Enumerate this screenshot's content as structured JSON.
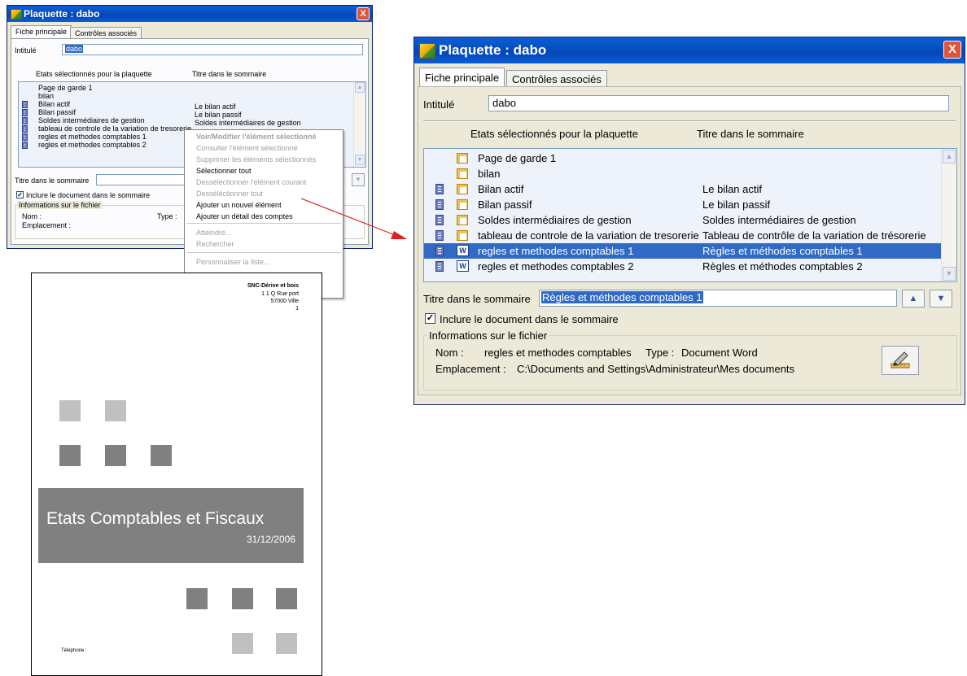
{
  "small_window": {
    "title": "Plaquette : dabo",
    "close": "X",
    "tabs": [
      "Fiche principale",
      "Contrôles associés"
    ],
    "intitule_label": "Intitulé",
    "intitule_value": "dabo",
    "col_states": "Etats sélectionnés pour la plaquette",
    "col_title": "Titre dans le sommaire",
    "rows": [
      {
        "name": "Page de garde 1",
        "title": ""
      },
      {
        "name": "bilan",
        "title": ""
      },
      {
        "name": "Bilan actif",
        "title": "Le bilan actif"
      },
      {
        "name": "Bilan passif",
        "title": "Le bilan passif"
      },
      {
        "name": "Soldes intermédiaires de gestion",
        "title": "Soldes intermédiaires de gestion"
      },
      {
        "name": "tableau de controle de la variation de tresorerie",
        "title": ""
      },
      {
        "name": "regles et methodes comptables 1",
        "title": ""
      },
      {
        "name": "regles et methodes comptables 2",
        "title": ""
      }
    ],
    "titre_label": "Titre dans le sommaire",
    "include_label": "Inclure le document dans le sommaire",
    "info_legend": "Informations sur le fichier",
    "nom_label": "Nom :",
    "type_label": "Type :",
    "emplacement_label": "Emplacement :"
  },
  "context_menu": {
    "items": [
      {
        "label": "Voir/Modifier l'élément sélectionné",
        "state": "bold"
      },
      {
        "label": "Consulter l'élément sélectionné",
        "state": "disabled"
      },
      {
        "label": "Supprimer les éléments sélectionnés",
        "state": "disabled"
      },
      {
        "label": "Sélectionner tout",
        "state": "enabled"
      },
      {
        "label": "Desséléctionner l'élément courant",
        "state": "disabled"
      },
      {
        "label": "Desséléctionner tout",
        "state": "disabled"
      },
      {
        "label": "Ajouter un nouvel élément",
        "state": "enabled"
      },
      {
        "label": "Ajouter un détail des comptes",
        "state": "enabled"
      },
      {
        "label": "Atteindre...",
        "state": "disabled"
      },
      {
        "label": "Rechercher",
        "state": "disabled"
      },
      {
        "label": "Personnaliser la liste...",
        "state": "disabled"
      }
    ]
  },
  "large_window": {
    "title": "Plaquette : dabo",
    "close": "X",
    "tabs": [
      "Fiche principale",
      "Contrôles associés"
    ],
    "intitule_label": "Intitulé",
    "intitule_value": "dabo",
    "col_states": "Etats sélectionnés pour la plaquette",
    "col_title": "Titre dans le sommaire",
    "rows": [
      {
        "name": "Page de garde 1",
        "title": "",
        "book": false,
        "icon": "sheet",
        "selected": false
      },
      {
        "name": "bilan",
        "title": "",
        "book": false,
        "icon": "sheet",
        "selected": false
      },
      {
        "name": "Bilan actif",
        "title": "Le bilan actif",
        "book": true,
        "icon": "sheet",
        "selected": false
      },
      {
        "name": "Bilan passif",
        "title": "Le bilan passif",
        "book": true,
        "icon": "sheet",
        "selected": false
      },
      {
        "name": "Soldes intermédiaires de gestion",
        "title": "Soldes intermédiaires de gestion",
        "book": true,
        "icon": "sheet",
        "selected": false
      },
      {
        "name": "tableau de controle de la variation de tresorerie",
        "title": "Tableau de contrôle de la variation de trésorerie",
        "book": true,
        "icon": "sheet",
        "selected": false
      },
      {
        "name": "regles et methodes comptables 1",
        "title": "Règles et méthodes comptables 1",
        "book": true,
        "icon": "word",
        "selected": true
      },
      {
        "name": "regles et methodes comptables 2",
        "title": "Règles et méthodes comptables 2",
        "book": true,
        "icon": "word",
        "selected": false
      }
    ],
    "titre_label": "Titre dans le sommaire",
    "titre_value": "Règles et méthodes comptables 1",
    "include_label": "Inclure le document dans le sommaire",
    "include_checked": true,
    "info_legend": "Informations sur le fichier",
    "nom_label": "Nom :",
    "nom_value": "regles et methodes comptables",
    "type_label": "Type :",
    "type_value": "Document Word",
    "emplacement_label": "Emplacement :",
    "emplacement_value": "C:\\Documents and Settings\\Administrateur\\Mes documents"
  },
  "cover_page": {
    "company": "SNC-Dérive et bois",
    "address": "1 1 Q Rue port",
    "city": "57000 Ville",
    "line4": "1",
    "title": "Etats Comptables et Fiscaux",
    "date": "31/12/2006",
    "telephone": "Téléphone :"
  },
  "colors": {
    "accent": "#316ac5",
    "arrow": "#e02020",
    "banner": "#808080",
    "square_dark": "#808080",
    "square_light": "#c0c0c0"
  }
}
